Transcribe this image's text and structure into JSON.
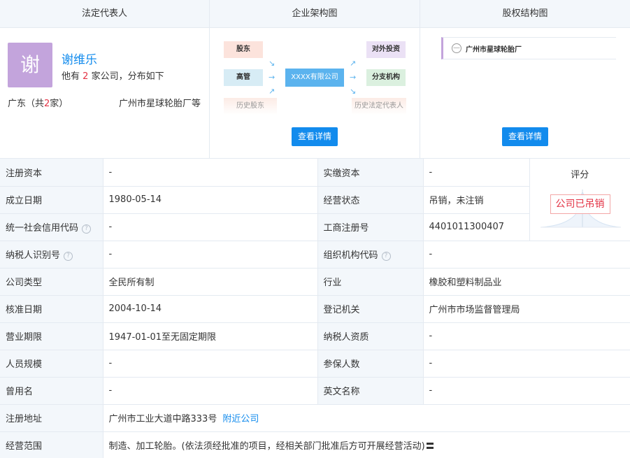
{
  "top": {
    "legal_rep": {
      "header": "法定代表人",
      "avatar_char": "谢",
      "name": "谢维乐",
      "sub_prefix": "他有",
      "sub_count": "2",
      "sub_suffix": "家公司，分布如下",
      "region_prefix": "广东（共",
      "region_count": "2",
      "region_suffix": "家）",
      "region_company": "广州市星球轮胎厂等"
    },
    "org_chart": {
      "header": "企业架构图",
      "shareholders": "股东",
      "executives": "高管",
      "history_shareholders": "历史股东",
      "center": "XXXX有限公司",
      "investments": "对外投资",
      "branches": "分支机构",
      "history_legal_rep": "历史法定代表人",
      "detail_button": "查看详情"
    },
    "equity": {
      "header": "股权结构图",
      "company": "广州市星球轮胎厂",
      "detail_button": "查看详情"
    }
  },
  "info_rows": [
    {
      "l1": "注册资本",
      "v1": "-",
      "l2": "实缴资本",
      "v2": "-"
    },
    {
      "l1": "成立日期",
      "v1": "1980-05-14",
      "l2": "经营状态",
      "v2": "吊销，未注销"
    },
    {
      "l1": "统一社会信用代码",
      "v1": "-",
      "l2": "工商注册号",
      "v2": "4401011300407"
    },
    {
      "l1": "纳税人识别号",
      "v1": "-",
      "l2": "组织机构代码",
      "v2": "-"
    },
    {
      "l1": "公司类型",
      "v1": "全民所有制",
      "l2": "行业",
      "v2": "橡胶和塑料制品业"
    },
    {
      "l1": "核准日期",
      "v1": "2004-10-14",
      "l2": "登记机关",
      "v2": "广州市市场监督管理局"
    },
    {
      "l1": "营业期限",
      "v1": "1947-01-01至无固定期限",
      "l2": "纳税人资质",
      "v2": "-"
    },
    {
      "l1": "人员规模",
      "v1": "-",
      "l2": "参保人数",
      "v2": "-"
    },
    {
      "l1": "曾用名",
      "v1": "-",
      "l2": "英文名称",
      "v2": "-"
    }
  ],
  "score": {
    "title": "评分",
    "stamp": "公司已吊销"
  },
  "address": {
    "label": "注册地址",
    "value": "广州市工业大道中路333号",
    "link": "附近公司"
  },
  "scope": {
    "label": "经营范围",
    "value": "制造、加工轮胎。(依法须经批准的项目，经相关部门批准后方可开展经营活动)"
  },
  "colors": {
    "brand_blue": "#128bed",
    "highlight_red": "#e33244",
    "label_bg": "#f3f7fb",
    "avatar_bg": "#c3a4dc"
  }
}
